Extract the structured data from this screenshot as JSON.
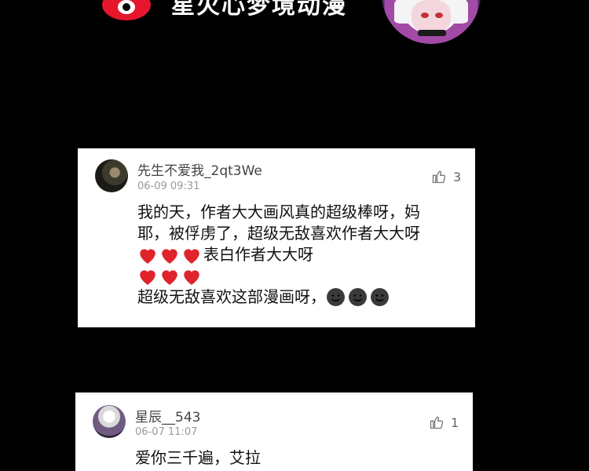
{
  "header": {
    "title": "星火心梦境动漫"
  },
  "comments": [
    {
      "username": "先生不爱我_2qt3We",
      "time": "06-09 09:31",
      "likes": "3",
      "lines": [
        "我的天，作者大大画风真的超级棒呀，妈",
        "耶，被俘虏了，超级无敌喜欢作者大大呀",
        "表白作者大大呀",
        "超级无敌喜欢这部漫画呀，"
      ]
    },
    {
      "username": "星辰__543",
      "time": "06-07 11:07",
      "likes": "1",
      "lines": [
        "爱你三千遍，艾拉"
      ]
    }
  ],
  "icons": {
    "like": "thumbs-up-icon",
    "heart": "red-heart-emoji",
    "smiley": "dark-smiley-emoji",
    "brand": "weibo-logo-icon"
  },
  "colors": {
    "background": "#000000",
    "card": "#ffffff",
    "heart": "#e0242c",
    "username": "#444444",
    "timestamp": "#999999"
  }
}
